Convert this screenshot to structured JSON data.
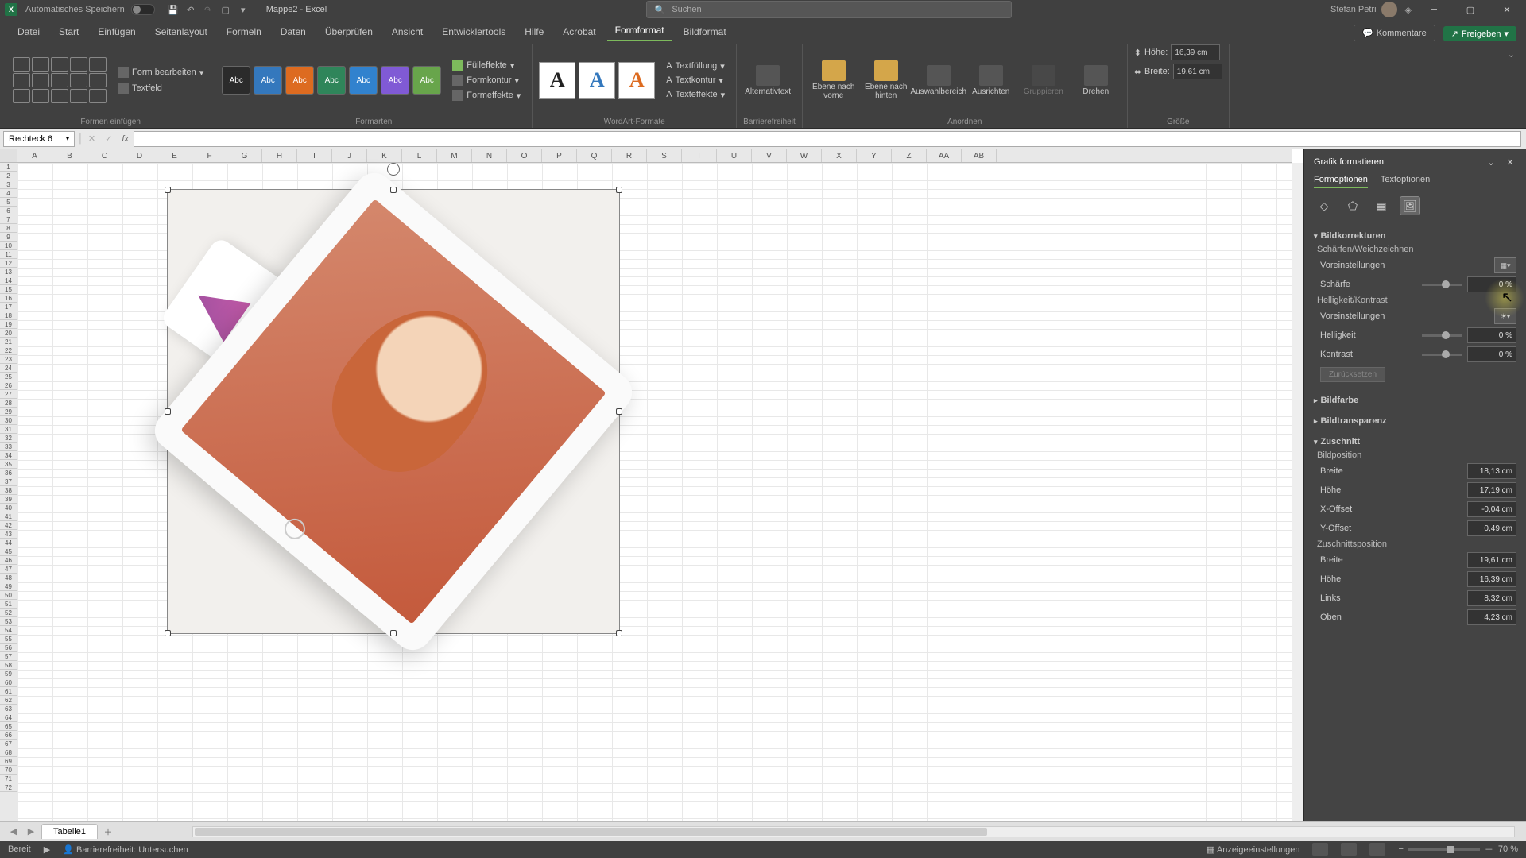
{
  "titlebar": {
    "autosave": "Automatisches Speichern",
    "doc": "Mappe2 - Excel",
    "search_ph": "Suchen",
    "user": "Stefan Petri"
  },
  "tabs": [
    "Datei",
    "Start",
    "Einfügen",
    "Seitenlayout",
    "Formeln",
    "Daten",
    "Überprüfen",
    "Ansicht",
    "Entwicklertools",
    "Hilfe",
    "Acrobat",
    "Formformat",
    "Bildformat"
  ],
  "active_tab": 11,
  "comments": "Kommentare",
  "share": "Freigeben",
  "ribbon": {
    "insert_shapes": "Formen einfügen",
    "edit_shape": "Form bearbeiten",
    "textbox": "Textfeld",
    "shape_styles": "Formarten",
    "fill": "Fülleffekte",
    "outline": "Formkontur",
    "effects": "Formeffekte",
    "wordart": "WordArt-Formate",
    "textfill": "Textfüllung",
    "textoutline": "Textkontur",
    "texteffects": "Texteffekte",
    "alt": "Alternativtext",
    "access": "Barrierefreiheit",
    "forward": "Ebene nach vorne",
    "backward": "Ebene nach hinten",
    "selpane": "Auswahlbereich",
    "align": "Ausrichten",
    "group": "Gruppieren",
    "rotate": "Drehen",
    "arrange": "Anordnen",
    "size": "Größe",
    "height_l": "Höhe:",
    "width_l": "Breite:",
    "height_v": "16,39 cm",
    "width_v": "19,61 cm"
  },
  "namebox": "Rechteck 6",
  "cols": [
    "A",
    "B",
    "C",
    "D",
    "E",
    "F",
    "G",
    "H",
    "I",
    "J",
    "K",
    "L",
    "M",
    "N",
    "O",
    "P",
    "Q",
    "R",
    "S",
    "T",
    "U",
    "V",
    "W",
    "X",
    "Y",
    "Z",
    "AA",
    "AB"
  ],
  "sheet": "Tabelle1",
  "pane": {
    "title": "Grafik formatieren",
    "tab1": "Formoptionen",
    "tab2": "Textoptionen",
    "s1": "Bildkorrekturen",
    "sharpen": "Schärfen/Weichzeichnen",
    "presets": "Voreinstellungen",
    "sharpness": "Schärfe",
    "bc": "Helligkeit/Kontrast",
    "brightness": "Helligkeit",
    "contrast": "Kontrast",
    "v0": "0 %",
    "reset": "Zurücksetzen",
    "s2": "Bildfarbe",
    "s3": "Bildtransparenz",
    "s4": "Zuschnitt",
    "picpos": "Bildposition",
    "width": "Breite",
    "height": "Höhe",
    "xoff": "X-Offset",
    "yoff": "Y-Offset",
    "croppos": "Zuschnittsposition",
    "left": "Links",
    "top": "Oben",
    "pp_w": "18,13 cm",
    "pp_h": "17,19 cm",
    "pp_x": "-0,04 cm",
    "pp_y": "0,49 cm",
    "cp_w": "19,61 cm",
    "cp_h": "16,39 cm",
    "cp_l": "8,32 cm",
    "cp_t": "4,23 cm"
  },
  "status": {
    "ready": "Bereit",
    "access": "Barrierefreiheit: Untersuchen",
    "display": "Anzeigeeinstellungen",
    "zoom": "70 %"
  },
  "swatches": [
    "#2b2b2b",
    "#3478bd",
    "#dd6b20",
    "#2f855a",
    "#3182ce",
    "#805ad5",
    "#68a54b"
  ]
}
